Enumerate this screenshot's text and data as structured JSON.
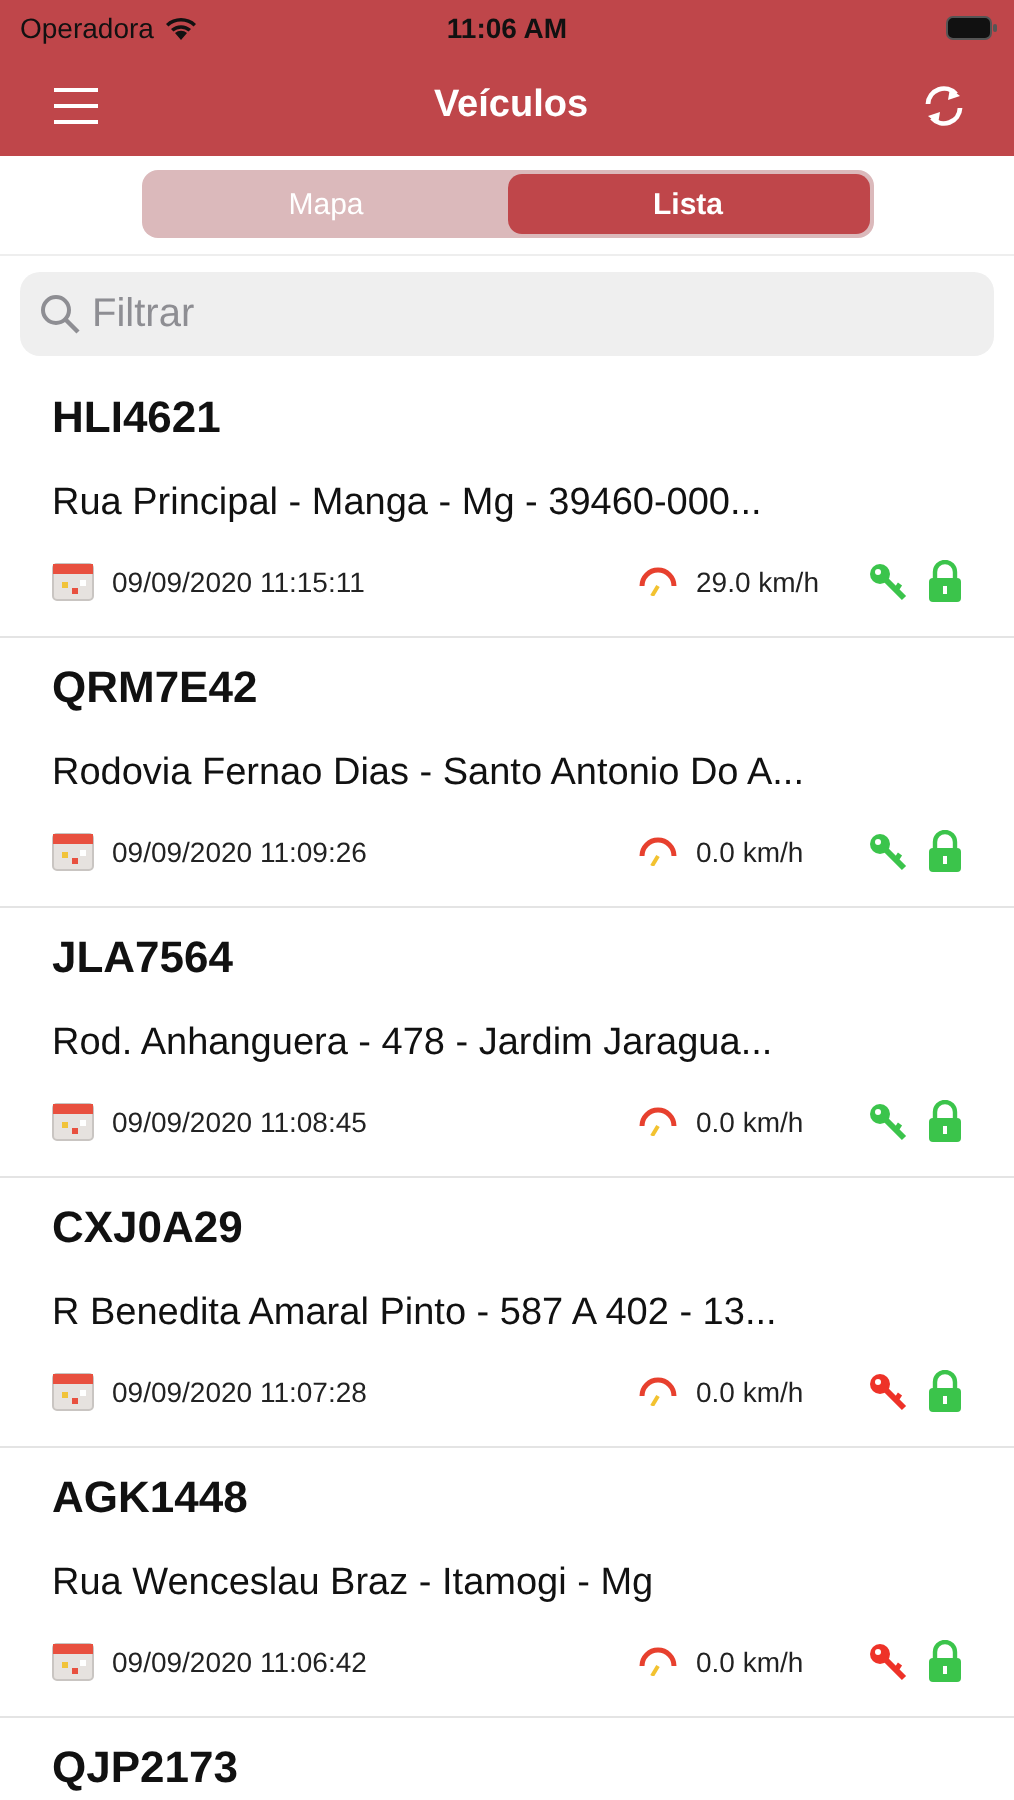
{
  "status_bar": {
    "carrier": "Operadora",
    "time": "11:06 AM"
  },
  "header": {
    "title": "Veículos"
  },
  "segments": [
    {
      "label": "Mapa",
      "selected": false
    },
    {
      "label": "Lista",
      "selected": true
    }
  ],
  "search": {
    "placeholder": "Filtrar"
  },
  "vehicles": [
    {
      "plate": "HLI4621",
      "address": "Rua Principal - Manga - Mg - 39460-000...",
      "datetime": "09/09/2020 11:15:11",
      "speed": "29.0 km/h",
      "ignition": true,
      "locked": true
    },
    {
      "plate": "QRM7E42",
      "address": "Rodovia Fernao Dias - Santo Antonio Do A...",
      "datetime": "09/09/2020 11:09:26",
      "speed": "0.0 km/h",
      "ignition": true,
      "locked": true
    },
    {
      "plate": "JLA7564",
      "address": "Rod. Anhanguera - 478 - Jardim Jaragua...",
      "datetime": "09/09/2020 11:08:45",
      "speed": "0.0 km/h",
      "ignition": true,
      "locked": true
    },
    {
      "plate": "CXJ0A29",
      "address": "R Benedita Amaral Pinto - 587 A 402 - 13...",
      "datetime": "09/09/2020 11:07:28",
      "speed": "0.0 km/h",
      "ignition": false,
      "locked": true
    },
    {
      "plate": "AGK1448",
      "address": "Rua Wenceslau Braz - Itamogi - Mg",
      "datetime": "09/09/2020 11:06:42",
      "speed": "0.0 km/h",
      "ignition": false,
      "locked": true
    },
    {
      "plate": "QJP2173"
    }
  ]
}
